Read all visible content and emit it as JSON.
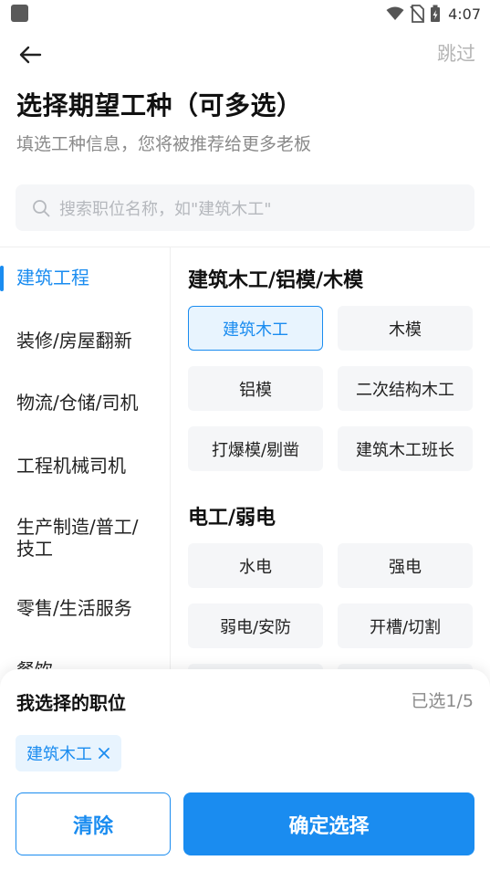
{
  "status_bar": {
    "time": "4:07",
    "icons": [
      "app-icon",
      "wifi-icon",
      "no-sim-icon",
      "battery-charging-icon"
    ]
  },
  "header": {
    "back_icon": "arrow-left-icon",
    "skip_label": "跳过"
  },
  "title": "选择期望工种（可多选）",
  "subtitle": "填选工种信息，您将被推荐给更多老板",
  "search": {
    "icon": "search-icon",
    "placeholder": "搜索职位名称，如\"建筑木工\""
  },
  "categories": [
    {
      "label": "建筑工程",
      "active": true
    },
    {
      "label": "装修/房屋翻新",
      "active": false
    },
    {
      "label": "物流/仓储/司机",
      "active": false
    },
    {
      "label": "工程机械司机",
      "active": false
    },
    {
      "label": "生产制造/普工/技工",
      "active": false
    },
    {
      "label": "零售/生活服务",
      "active": false
    },
    {
      "label": "餐饮",
      "active": false
    }
  ],
  "groups": [
    {
      "title": "建筑木工/铝模/木模",
      "items": [
        {
          "label": "建筑木工",
          "selected": true
        },
        {
          "label": "木模",
          "selected": false
        },
        {
          "label": "铝模",
          "selected": false
        },
        {
          "label": "二次结构木工",
          "selected": false
        },
        {
          "label": "打爆模/剔凿",
          "selected": false
        },
        {
          "label": "建筑木工班长",
          "selected": false
        }
      ]
    },
    {
      "title": "电工/弱电",
      "items": [
        {
          "label": "水电",
          "selected": false
        },
        {
          "label": "强电",
          "selected": false
        },
        {
          "label": "弱电/安防",
          "selected": false
        },
        {
          "label": "开槽/切割",
          "selected": false
        }
      ]
    }
  ],
  "bottom_sheet": {
    "title": "我选择的职位",
    "count": "已选1/5",
    "selected": [
      {
        "label": "建筑木工",
        "close_icon": "close-icon"
      }
    ],
    "clear_label": "清除",
    "confirm_label": "确定选择"
  },
  "colors": {
    "accent": "#1a8cf0",
    "chip_bg": "#f5f6f8",
    "selected_bg": "#e8f4fe",
    "muted_text": "#8a8a8a"
  }
}
